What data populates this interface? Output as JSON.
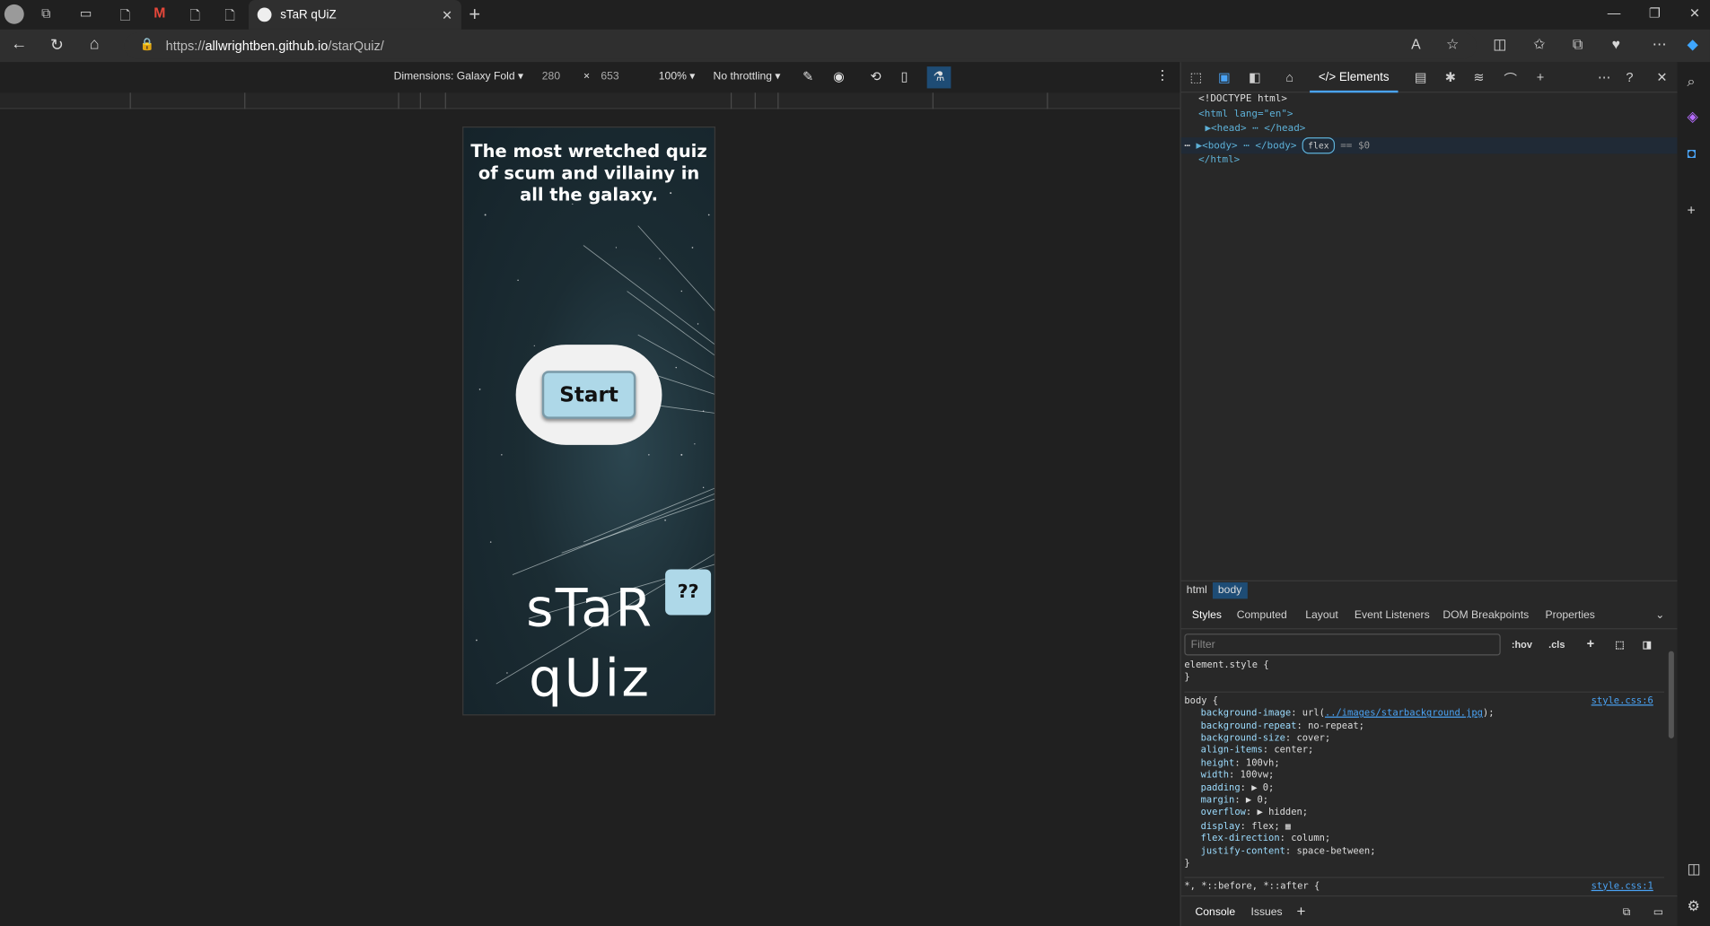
{
  "browser": {
    "active_tab_title": "sTaR qUiZ",
    "url_prefix": "https://",
    "url_host": "allwrightben.github.io",
    "url_path": "/starQuiz/"
  },
  "device_toolbar": {
    "dimensions_label": "Dimensions: Galaxy Fold",
    "width": "280",
    "times": "×",
    "height": "653",
    "zoom": "100%",
    "throttling": "No throttling"
  },
  "page": {
    "title": "The most wretched quiz of scum and villainy in all the galaxy.",
    "start_label": "Start",
    "help_label": "??",
    "brand_line1": "sTaR",
    "brand_line2": "qUiz"
  },
  "devtools": {
    "elements_tab": "Elements",
    "dom_lines": [
      "<!DOCTYPE html>",
      "<html lang=\"en\">",
      "<head> ⋯ </head>",
      "<body> ⋯ </body>",
      "</html>"
    ],
    "flex_badge": "flex",
    "eq_sel": "== $0",
    "breadcrumb": [
      "html",
      "body"
    ],
    "subtabs": [
      "Styles",
      "Computed",
      "Layout",
      "Event Listeners",
      "DOM Breakpoints",
      "Properties"
    ],
    "filter_placeholder": "Filter",
    "hov": ":hov",
    "cls": ".cls",
    "element_style": "element.style {",
    "close_brace": "}",
    "body_selector": "body {",
    "source1": "style.css:6",
    "source2": "style.css:1",
    "bg_image_prop": "background-image",
    "bg_image_url": "../images/starbackground.jpg",
    "props": [
      [
        "background-repeat",
        "no-repeat;"
      ],
      [
        "background-size",
        "cover;"
      ],
      [
        "align-items",
        "center;"
      ],
      [
        "height",
        "100vh;"
      ],
      [
        "width",
        "100vw;"
      ],
      [
        "padding",
        "▶ 0;"
      ],
      [
        "margin",
        "▶ 0;"
      ],
      [
        "overflow",
        "▶ hidden;"
      ],
      [
        "display",
        "flex;"
      ],
      [
        "flex-direction",
        "column;"
      ],
      [
        "justify-content",
        "space-between;"
      ]
    ],
    "universal_selector": "*, *::before, *::after {",
    "console_tab": "Console",
    "issues_tab": "Issues"
  }
}
